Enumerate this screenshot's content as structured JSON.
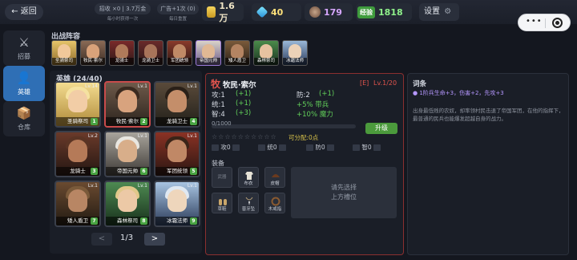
{
  "topbar": {
    "back_label": "← 返回",
    "recruit_pill": "招收 ×0 | 3.7万金",
    "recruit_sub": "每小时获得一次",
    "ad_pill": "广告+1次 (0)",
    "ad_sub": "每日重置",
    "gold": "1.6万",
    "diamond": "40",
    "potion": "179",
    "exp_label": "经验",
    "exp": "1818",
    "settings_label": "设置"
  },
  "nav": [
    {
      "label": "招募",
      "icon": "swords-icon"
    },
    {
      "label": "英雄",
      "icon": "hero-icon"
    },
    {
      "label": "仓库",
      "icon": "box-icon"
    }
  ],
  "lineup": {
    "title": "出战阵容",
    "heroes": [
      "圣骑祭司",
      "牧民·索尔",
      "龙骑士",
      "龙骑卫士",
      "军团统领",
      "帝国元帅",
      "矮人盾卫",
      "森林祭司",
      "冰霜法师"
    ]
  },
  "herolist": {
    "title": "英雄 (24/40)",
    "cards": [
      {
        "name": "圣骑祭司",
        "lv": "Lv.14",
        "num": "1"
      },
      {
        "name": "牧民·索尔",
        "lv": "Lv.1",
        "num": "2"
      },
      {
        "name": "龙骑卫士",
        "lv": "Lv.1",
        "num": "4"
      },
      {
        "name": "龙骑士",
        "lv": "Lv.2",
        "num": "3"
      },
      {
        "name": "帝国元帅",
        "lv": "Lv.1",
        "num": "6"
      },
      {
        "name": "军团统领",
        "lv": "Lv.1",
        "num": "5"
      },
      {
        "name": "矮人盾卫",
        "lv": "Lv.1",
        "num": "7"
      },
      {
        "name": "森林祭司",
        "lv": "Lv.1",
        "num": "8"
      },
      {
        "name": "冰霜法师",
        "lv": "Lv.1",
        "num": "9"
      }
    ],
    "page": "1/3",
    "prev": "<",
    "next": ">"
  },
  "detail": {
    "badge": "牧",
    "name": "牧民·索尔",
    "rarity": "[E]",
    "level": "Lv.1/20",
    "atk_label": "攻:1",
    "atk_bonus": "(+1)",
    "def_label": "防:2",
    "def_bonus": "(+1)",
    "cmd_label": "统:1",
    "cmd_bonus": "(+1)",
    "int_label": "智:4",
    "int_bonus": "(+3)",
    "bonus1": "+5% 带兵",
    "bonus2": "+10% 魔力",
    "exp_text": "0/1000",
    "exp_fraction": 0,
    "upgrade": "升级",
    "stars": "☆☆☆☆☆☆☆☆☆☆",
    "allocatable": "可分配:0点",
    "alloc": [
      {
        "label": "攻",
        "value": "0"
      },
      {
        "label": "统",
        "value": "0"
      },
      {
        "label": "防",
        "value": "0"
      },
      {
        "label": "智",
        "value": "0"
      }
    ],
    "equip_title": "装备",
    "equip": [
      {
        "name": "武器"
      },
      {
        "name": "布衣"
      },
      {
        "name": "皮帽"
      },
      {
        "name": "草鞋"
      },
      {
        "name": "普牙坠"
      },
      {
        "name": "木戒指"
      }
    ],
    "choose_line1": "请先选择",
    "choose_line2": "上方槽位"
  },
  "talent": {
    "title": "词条",
    "bullet": "● 1阶兵生命+3，伤害+2，先攻+3",
    "desc": "出身最低贱的农奴，却率领村民击退了帝国军团，在他的指挥下，最普通的民兵也能爆发超越自身的战力。"
  }
}
